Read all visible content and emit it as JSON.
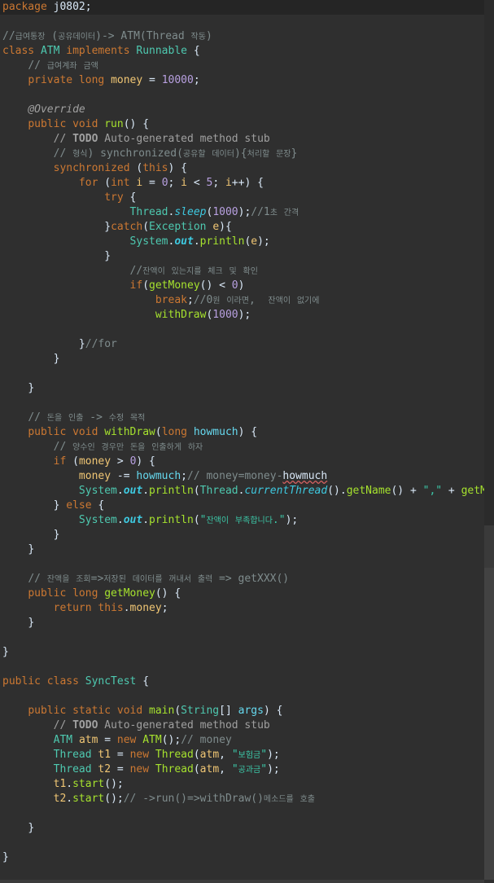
{
  "editor": {
    "lines": [
      [
        [
          "k",
          "package "
        ],
        [
          "p",
          "j0802;"
        ]
      ],
      [],
      [
        [
          "c",
          "//급여통장 (공유데이터)-> ATM(Thread 작동)"
        ]
      ],
      [
        [
          "k",
          "class "
        ],
        [
          "cls",
          "ATM "
        ],
        [
          "k",
          "implements "
        ],
        [
          "cls",
          "Runnable "
        ],
        [
          "p",
          "{"
        ]
      ],
      [
        [
          "p",
          "    "
        ],
        [
          "c",
          "// 급여계좌 금액"
        ]
      ],
      [
        [
          "p",
          "    "
        ],
        [
          "k",
          "private long "
        ],
        [
          "v",
          "money "
        ],
        [
          "p",
          "= "
        ],
        [
          "n",
          "10000"
        ],
        [
          "p",
          ";"
        ]
      ],
      [],
      [
        [
          "p",
          "    "
        ],
        [
          "ann",
          "@Override"
        ]
      ],
      [
        [
          "p",
          "    "
        ],
        [
          "k",
          "public void "
        ],
        [
          "f",
          "run"
        ],
        [
          "p",
          "() {"
        ]
      ],
      [
        [
          "p",
          "        "
        ],
        [
          "ck",
          "// "
        ],
        [
          "cb",
          "TODO"
        ],
        [
          "ck",
          " Auto-generated method stub"
        ]
      ],
      [
        [
          "p",
          "        "
        ],
        [
          "c",
          "// 형식) synchronized(공유할 데이터){처리할 문장}"
        ]
      ],
      [
        [
          "p",
          "        "
        ],
        [
          "k",
          "synchronized "
        ],
        [
          "p",
          "("
        ],
        [
          "k",
          "this"
        ],
        [
          "p",
          ") {"
        ]
      ],
      [
        [
          "p",
          "            "
        ],
        [
          "k",
          "for "
        ],
        [
          "p",
          "("
        ],
        [
          "k",
          "int "
        ],
        [
          "v",
          "i "
        ],
        [
          "p",
          "= "
        ],
        [
          "n",
          "0"
        ],
        [
          "p",
          "; "
        ],
        [
          "v",
          "i "
        ],
        [
          "p",
          "< "
        ],
        [
          "n",
          "5"
        ],
        [
          "p",
          "; "
        ],
        [
          "v",
          "i"
        ],
        [
          "p",
          "++) {"
        ]
      ],
      [
        [
          "p",
          "                "
        ],
        [
          "k",
          "try "
        ],
        [
          "p",
          "{"
        ]
      ],
      [
        [
          "p",
          "                    "
        ],
        [
          "cls",
          "Thread"
        ],
        [
          "p",
          "."
        ],
        [
          "si",
          "sleep"
        ],
        [
          "p",
          "("
        ],
        [
          "n",
          "1000"
        ],
        [
          "p",
          ");"
        ],
        [
          "c",
          "//1초 간격"
        ]
      ],
      [
        [
          "p",
          "                "
        ],
        [
          "p",
          "}"
        ],
        [
          "k",
          "catch"
        ],
        [
          "p",
          "("
        ],
        [
          "cls",
          "Exception "
        ],
        [
          "v",
          "e"
        ],
        [
          "p",
          "){"
        ]
      ],
      [
        [
          "p",
          "                    "
        ],
        [
          "cls",
          "System"
        ],
        [
          "p",
          "."
        ],
        [
          "st",
          "out"
        ],
        [
          "p",
          "."
        ],
        [
          "f",
          "println"
        ],
        [
          "p",
          "("
        ],
        [
          "v",
          "e"
        ],
        [
          "p",
          ");"
        ]
      ],
      [
        [
          "p",
          "                "
        ],
        [
          "p",
          "}"
        ]
      ],
      [
        [
          "p",
          "                    "
        ],
        [
          "c",
          "//잔액이 있는지를 체크 및 확인"
        ]
      ],
      [
        [
          "p",
          "                    "
        ],
        [
          "k",
          "if"
        ],
        [
          "p",
          "("
        ],
        [
          "f",
          "getMoney"
        ],
        [
          "p",
          "() < "
        ],
        [
          "n",
          "0"
        ],
        [
          "p",
          ")"
        ]
      ],
      [
        [
          "p",
          "                        "
        ],
        [
          "k",
          "break"
        ],
        [
          "p",
          ";"
        ],
        [
          "c",
          "//0원 이라면,  잔액이 없기에"
        ]
      ],
      [
        [
          "p",
          "                        "
        ],
        [
          "f",
          "withDraw"
        ],
        [
          "p",
          "("
        ],
        [
          "n",
          "1000"
        ],
        [
          "p",
          ");"
        ]
      ],
      [],
      [
        [
          "p",
          "            "
        ],
        [
          "p",
          "}"
        ],
        [
          "c",
          "//for"
        ]
      ],
      [
        [
          "p",
          "        "
        ],
        [
          "p",
          "}"
        ]
      ],
      [],
      [
        [
          "p",
          "    "
        ],
        [
          "p",
          "}"
        ]
      ],
      [],
      [
        [
          "p",
          "    "
        ],
        [
          "c",
          "// 돈을 인출 -> 수정 목적"
        ]
      ],
      [
        [
          "p",
          "    "
        ],
        [
          "k",
          "public void "
        ],
        [
          "f",
          "withDraw"
        ],
        [
          "p",
          "("
        ],
        [
          "k",
          "long "
        ],
        [
          "fld",
          "howmuch"
        ],
        [
          "p",
          ") {"
        ]
      ],
      [
        [
          "p",
          "        "
        ],
        [
          "c",
          "// 양수인 경우만 돈을 인출하게 하자"
        ]
      ],
      [
        [
          "p",
          "        "
        ],
        [
          "k",
          "if "
        ],
        [
          "p",
          "("
        ],
        [
          "v",
          "money "
        ],
        [
          "p",
          "> "
        ],
        [
          "n",
          "0"
        ],
        [
          "p",
          ") {"
        ]
      ],
      [
        [
          "p",
          "            "
        ],
        [
          "v",
          "money "
        ],
        [
          "p",
          "-= "
        ],
        [
          "fld",
          "howmuch"
        ],
        [
          "p",
          ";"
        ],
        [
          "c",
          "// money=money-"
        ],
        [
          "sq",
          "howmuch"
        ]
      ],
      [
        [
          "p",
          "            "
        ],
        [
          "cls",
          "System"
        ],
        [
          "p",
          "."
        ],
        [
          "st",
          "out"
        ],
        [
          "p",
          "."
        ],
        [
          "f",
          "println"
        ],
        [
          "p",
          "("
        ],
        [
          "cls",
          "Thread"
        ],
        [
          "p",
          "."
        ],
        [
          "si",
          "currentThread"
        ],
        [
          "p",
          "()."
        ],
        [
          "f",
          "getName"
        ],
        [
          "p",
          "() + "
        ],
        [
          "s",
          "\",\""
        ],
        [
          "p",
          " + "
        ],
        [
          "f",
          "getM"
        ]
      ],
      [
        [
          "p",
          "        "
        ],
        [
          "p",
          "} "
        ],
        [
          "k",
          "else "
        ],
        [
          "p",
          "{"
        ]
      ],
      [
        [
          "p",
          "            "
        ],
        [
          "cls",
          "System"
        ],
        [
          "p",
          "."
        ],
        [
          "st",
          "out"
        ],
        [
          "p",
          "."
        ],
        [
          "f",
          "println"
        ],
        [
          "p",
          "("
        ],
        [
          "s",
          "\"잔액이 부족합니다.\""
        ],
        [
          "p",
          ");"
        ]
      ],
      [
        [
          "p",
          "        "
        ],
        [
          "p",
          "}"
        ]
      ],
      [
        [
          "p",
          "    "
        ],
        [
          "p",
          "}"
        ]
      ],
      [],
      [
        [
          "p",
          "    "
        ],
        [
          "c",
          "// 잔액을 조회=>저장된 데이터를 꺼내서 출력 => getXXX()"
        ]
      ],
      [
        [
          "p",
          "    "
        ],
        [
          "k",
          "public long "
        ],
        [
          "f",
          "getMoney"
        ],
        [
          "p",
          "() {"
        ]
      ],
      [
        [
          "p",
          "        "
        ],
        [
          "k",
          "return this"
        ],
        [
          "p",
          "."
        ],
        [
          "v",
          "money"
        ],
        [
          "p",
          ";"
        ]
      ],
      [
        [
          "p",
          "    "
        ],
        [
          "p",
          "}"
        ]
      ],
      [],
      [
        [
          "p",
          "}"
        ]
      ],
      [],
      [
        [
          "k",
          "public class "
        ],
        [
          "cls",
          "SyncTest "
        ],
        [
          "p",
          "{"
        ]
      ],
      [],
      [
        [
          "p",
          "    "
        ],
        [
          "k",
          "public static void "
        ],
        [
          "f",
          "main"
        ],
        [
          "p",
          "("
        ],
        [
          "cls",
          "String"
        ],
        [
          "p",
          "[] "
        ],
        [
          "fld",
          "args"
        ],
        [
          "p",
          ") {"
        ]
      ],
      [
        [
          "p",
          "        "
        ],
        [
          "ck",
          "// "
        ],
        [
          "cb",
          "TODO"
        ],
        [
          "ck",
          " Auto-generated method stub"
        ]
      ],
      [
        [
          "p",
          "        "
        ],
        [
          "cls",
          "ATM "
        ],
        [
          "v",
          "atm "
        ],
        [
          "p",
          "= "
        ],
        [
          "k",
          "new "
        ],
        [
          "f",
          "ATM"
        ],
        [
          "p",
          "();"
        ],
        [
          "c",
          "// money"
        ]
      ],
      [
        [
          "p",
          "        "
        ],
        [
          "cls",
          "Thread "
        ],
        [
          "v",
          "t1 "
        ],
        [
          "p",
          "= "
        ],
        [
          "k",
          "new "
        ],
        [
          "f",
          "Thread"
        ],
        [
          "p",
          "("
        ],
        [
          "v",
          "atm"
        ],
        [
          "p",
          ", "
        ],
        [
          "s",
          "\"보험금\""
        ],
        [
          "p",
          ");"
        ]
      ],
      [
        [
          "p",
          "        "
        ],
        [
          "cls",
          "Thread "
        ],
        [
          "v",
          "t2 "
        ],
        [
          "p",
          "= "
        ],
        [
          "k",
          "new "
        ],
        [
          "f",
          "Thread"
        ],
        [
          "p",
          "("
        ],
        [
          "v",
          "atm"
        ],
        [
          "p",
          ", "
        ],
        [
          "s",
          "\"공과금\""
        ],
        [
          "p",
          ");"
        ]
      ],
      [
        [
          "p",
          "        "
        ],
        [
          "v",
          "t1"
        ],
        [
          "p",
          "."
        ],
        [
          "f",
          "start"
        ],
        [
          "p",
          "();"
        ]
      ],
      [
        [
          "p",
          "        "
        ],
        [
          "v",
          "t2"
        ],
        [
          "p",
          "."
        ],
        [
          "f",
          "start"
        ],
        [
          "p",
          "();"
        ],
        [
          "c",
          "// ->run()=>withDraw()메소드를 호출"
        ]
      ],
      [],
      [
        [
          "p",
          "    "
        ],
        [
          "p",
          "}"
        ]
      ],
      [],
      [
        [
          "p",
          "}"
        ]
      ]
    ]
  }
}
